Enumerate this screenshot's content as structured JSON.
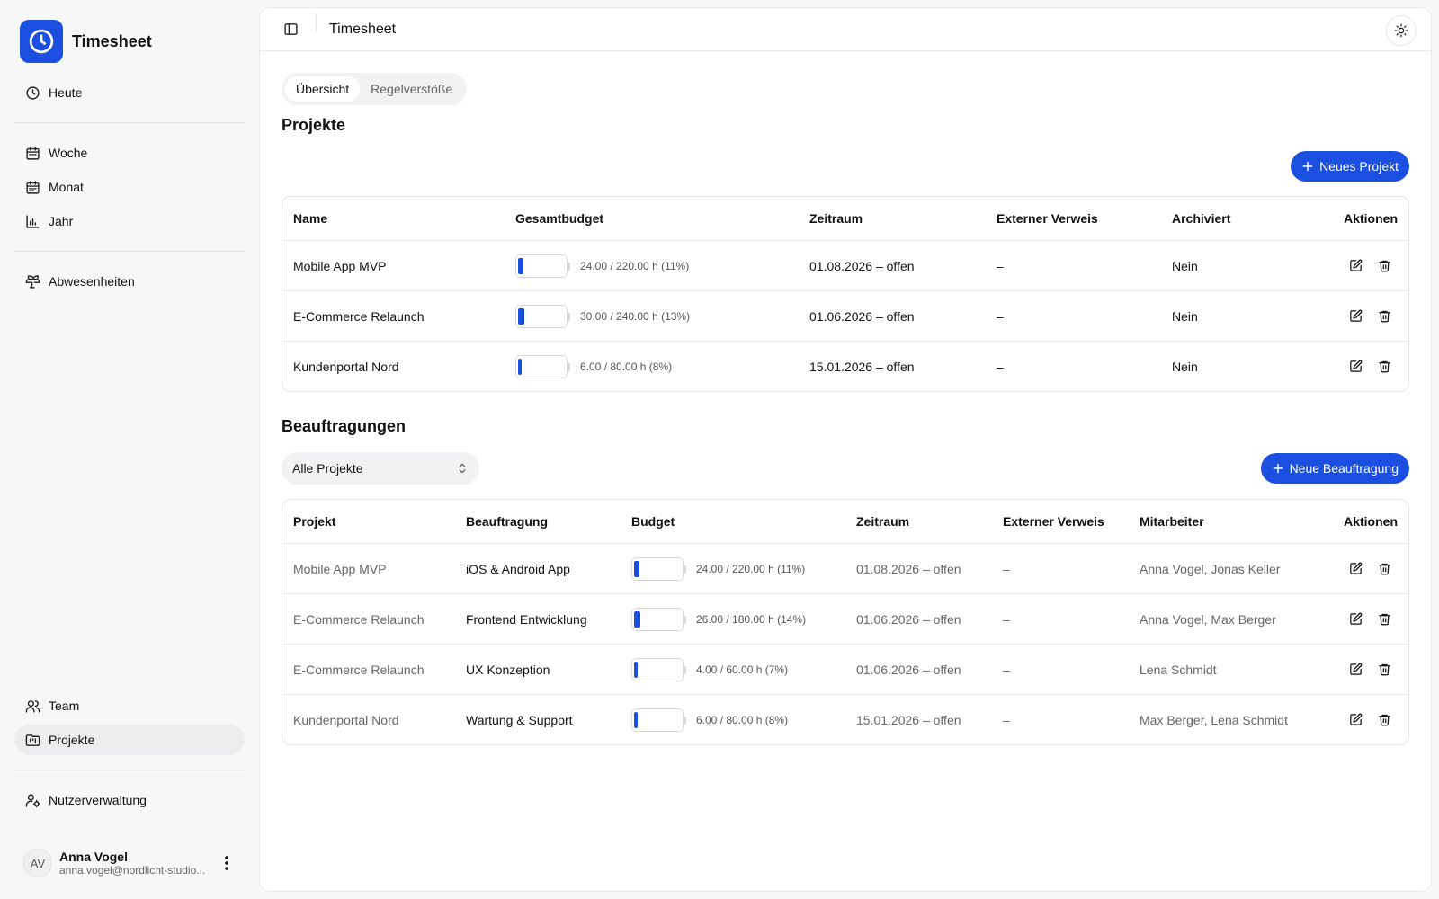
{
  "app": {
    "title": "Timesheet"
  },
  "colors": {
    "accent": "#1a4fe0"
  },
  "sidebar": {
    "groups": [
      [
        {
          "label": "Heute",
          "icon": "clock-icon"
        }
      ],
      [
        {
          "label": "Woche",
          "icon": "calendar-week-icon"
        },
        {
          "label": "Monat",
          "icon": "calendar-month-icon"
        },
        {
          "label": "Jahr",
          "icon": "bar-chart-icon"
        }
      ],
      [
        {
          "label": "Abwesenheiten",
          "icon": "palm-tree-icon"
        }
      ]
    ],
    "bottom": [
      {
        "label": "Team",
        "icon": "users-icon"
      },
      {
        "label": "Projekte",
        "icon": "folder-kanban-icon",
        "active": true
      }
    ],
    "admin": {
      "label": "Nutzerverwaltung",
      "icon": "user-cog-icon"
    },
    "user": {
      "initials": "AV",
      "name": "Anna Vogel",
      "email": "anna.vogel@nordlicht-studio..."
    }
  },
  "header": {
    "title": "Timesheet"
  },
  "tabs": [
    {
      "label": "Übersicht",
      "active": true
    },
    {
      "label": "Regelverstöße",
      "active": false
    }
  ],
  "projects": {
    "title": "Projekte",
    "new_button": "Neues Projekt",
    "columns": [
      "Name",
      "Gesamtbudget",
      "Zeitraum",
      "Externer Verweis",
      "Archiviert",
      "Aktionen"
    ],
    "rows": [
      {
        "name": "Mobile App MVP",
        "budget_text": "24.00 / 220.00 h (11%)",
        "progress": 0.11,
        "period": "01.08.2026 – offen",
        "external": "–",
        "archived": "Nein"
      },
      {
        "name": "E-Commerce Relaunch",
        "budget_text": "30.00 / 240.00 h (13%)",
        "progress": 0.13,
        "period": "01.06.2026 – offen",
        "external": "–",
        "archived": "Nein"
      },
      {
        "name": "Kundenportal Nord",
        "budget_text": "6.00 / 80.00 h (8%)",
        "progress": 0.08,
        "period": "15.01.2026 – offen",
        "external": "–",
        "archived": "Nein"
      }
    ]
  },
  "assignments": {
    "title": "Beauftragungen",
    "filter": "Alle Projekte",
    "new_button": "Neue Beauftragung",
    "columns": [
      "Projekt",
      "Beauftragung",
      "Budget",
      "Zeitraum",
      "Externer Verweis",
      "Mitarbeiter",
      "Aktionen"
    ],
    "rows": [
      {
        "project": "Mobile App MVP",
        "name": "iOS & Android App",
        "budget_text": "24.00 / 220.00 h (11%)",
        "progress": 0.11,
        "period": "01.08.2026 – offen",
        "external": "–",
        "staff": "Anna Vogel, Jonas Keller"
      },
      {
        "project": "E-Commerce Relaunch",
        "name": "Frontend Entwicklung",
        "budget_text": "26.00 / 180.00 h (14%)",
        "progress": 0.14,
        "period": "01.06.2026 – offen",
        "external": "–",
        "staff": "Anna Vogel, Max Berger"
      },
      {
        "project": "E-Commerce Relaunch",
        "name": "UX Konzeption",
        "budget_text": "4.00 / 60.00 h (7%)",
        "progress": 0.07,
        "period": "01.06.2026 – offen",
        "external": "–",
        "staff": "Lena Schmidt"
      },
      {
        "project": "Kundenportal Nord",
        "name": "Wartung & Support",
        "budget_text": "6.00 / 80.00 h (8%)",
        "progress": 0.08,
        "period": "15.01.2026 – offen",
        "external": "–",
        "staff": "Max Berger, Lena Schmidt"
      }
    ]
  }
}
